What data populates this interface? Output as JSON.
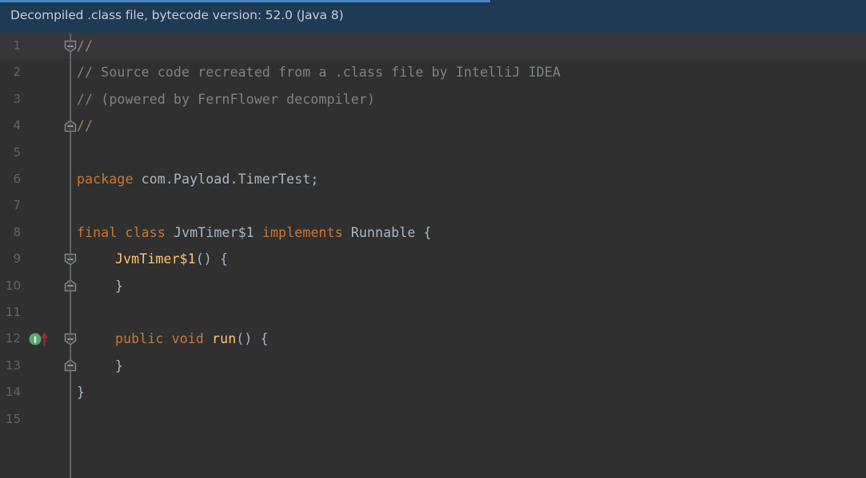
{
  "banner": {
    "message": "Decompiled .class file, bytecode version: 52.0 (Java 8)",
    "background_color": "#1f3a55",
    "text_color": "#c3cdd6",
    "accent_color": "#4a88c7"
  },
  "editor": {
    "background_color": "#2f302f",
    "caret_row_color": "#353739",
    "gutter_text_color": "#60656a",
    "line_count": 15,
    "caret_line": 1,
    "line_numbers": [
      "1",
      "2",
      "3",
      "4",
      "5",
      "6",
      "7",
      "8",
      "9",
      "10",
      "11",
      "12",
      "13",
      "14",
      "15"
    ],
    "syntax_colors": {
      "keyword": "#cc7832",
      "identifier": "#a9b7c6",
      "method": "#ffc66d",
      "comment": "#7f8285",
      "comment_slash": "#9e8666"
    },
    "lines": [
      {
        "number": "1",
        "indent": 0,
        "tokens": [
          {
            "t": "//",
            "c": "cmtslash"
          }
        ]
      },
      {
        "number": "2",
        "indent": 0,
        "tokens": [
          {
            "t": "// Source code recreated from a .class file by IntelliJ IDEA",
            "c": "cmt"
          }
        ]
      },
      {
        "number": "3",
        "indent": 0,
        "tokens": [
          {
            "t": "// (powered by FernFlower decompiler)",
            "c": "cmt"
          }
        ]
      },
      {
        "number": "4",
        "indent": 0,
        "tokens": [
          {
            "t": "//",
            "c": "cmtslash"
          }
        ]
      },
      {
        "number": "5",
        "indent": 0,
        "tokens": []
      },
      {
        "number": "6",
        "indent": 0,
        "tokens": [
          {
            "t": "package",
            "c": "kw"
          },
          {
            "t": " com.Payload.TimerTest;",
            "c": "id"
          }
        ]
      },
      {
        "number": "7",
        "indent": 0,
        "tokens": []
      },
      {
        "number": "8",
        "indent": 0,
        "tokens": [
          {
            "t": "final",
            "c": "kw"
          },
          {
            "t": " ",
            "c": "id"
          },
          {
            "t": "class",
            "c": "kw"
          },
          {
            "t": " JvmTimer$1 ",
            "c": "id"
          },
          {
            "t": "implements",
            "c": "kw"
          },
          {
            "t": " Runnable {",
            "c": "id"
          }
        ]
      },
      {
        "number": "9",
        "indent": 1,
        "tokens": [
          {
            "t": "JvmTimer$1",
            "c": "mth"
          },
          {
            "t": "() {",
            "c": "punc"
          }
        ]
      },
      {
        "number": "10",
        "indent": 1,
        "tokens": [
          {
            "t": "}",
            "c": "punc"
          }
        ]
      },
      {
        "number": "11",
        "indent": 0,
        "tokens": []
      },
      {
        "number": "12",
        "indent": 1,
        "tokens": [
          {
            "t": "public",
            "c": "kw"
          },
          {
            "t": " ",
            "c": "id"
          },
          {
            "t": "void",
            "c": "kw"
          },
          {
            "t": " ",
            "c": "id"
          },
          {
            "t": "run",
            "c": "mth"
          },
          {
            "t": "() {",
            "c": "punc"
          }
        ]
      },
      {
        "number": "13",
        "indent": 1,
        "tokens": [
          {
            "t": "}",
            "c": "punc"
          }
        ]
      },
      {
        "number": "14",
        "indent": 0,
        "tokens": [
          {
            "t": "}",
            "c": "punc"
          }
        ]
      },
      {
        "number": "15",
        "indent": 0,
        "tokens": []
      }
    ],
    "fold_markers": [
      {
        "line": "1",
        "direction": "collapse-start"
      },
      {
        "line": "4",
        "direction": "collapse-end"
      },
      {
        "line": "9",
        "direction": "collapse-start"
      },
      {
        "line": "10",
        "direction": "collapse-end"
      },
      {
        "line": "12",
        "direction": "collapse-start"
      },
      {
        "line": "13",
        "direction": "collapse-end"
      }
    ],
    "gutter_icons": [
      {
        "line": "12",
        "name": "implementing-method-icon",
        "glyph": "I",
        "badge_color": "#59a869",
        "arrow_color": "#9b2d30"
      }
    ]
  }
}
